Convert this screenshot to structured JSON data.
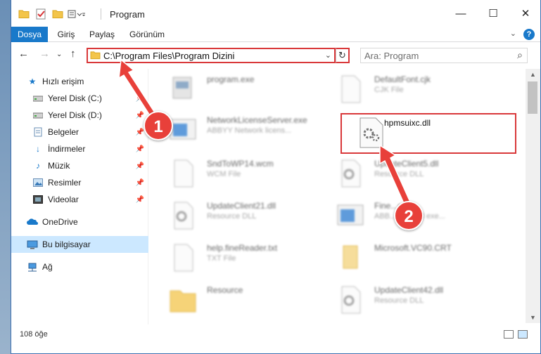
{
  "window": {
    "title": "Program",
    "controls": {
      "minimize": "—",
      "maximize": "☐",
      "close": "✕"
    }
  },
  "ribbon": {
    "tabs": [
      {
        "label": "Dosya",
        "active": true
      },
      {
        "label": "Giriş",
        "active": false
      },
      {
        "label": "Paylaş",
        "active": false
      },
      {
        "label": "Görünüm",
        "active": false
      }
    ],
    "help": "?"
  },
  "address": {
    "path": "C:\\Program Files\\Program Dizini"
  },
  "search": {
    "placeholder": "Ara: Program"
  },
  "sidebar": {
    "items": [
      {
        "label": "Hızlı erişim",
        "icon": "star-icon",
        "pinned": false
      },
      {
        "label": "Yerel Disk (C:)",
        "icon": "drive-icon",
        "pinned": true
      },
      {
        "label": "Yerel Disk (D:)",
        "icon": "drive-icon",
        "pinned": true
      },
      {
        "label": "Belgeler",
        "icon": "documents-icon",
        "pinned": true
      },
      {
        "label": "İndirmeler",
        "icon": "download-icon",
        "pinned": true
      },
      {
        "label": "Müzik",
        "icon": "music-icon",
        "pinned": true
      },
      {
        "label": "Resimler",
        "icon": "pictures-icon",
        "pinned": true
      },
      {
        "label": "Videolar",
        "icon": "videos-icon",
        "pinned": true
      },
      {
        "label": "OneDrive",
        "icon": "cloud-icon",
        "pinned": false
      },
      {
        "label": "Bu bilgisayar",
        "icon": "computer-icon",
        "pinned": false,
        "selected": true
      },
      {
        "label": "Ağ",
        "icon": "network-icon",
        "pinned": false
      }
    ]
  },
  "files": [
    {
      "name": "program.exe",
      "sub": "",
      "icon": "exe-icon"
    },
    {
      "name": "DefaultFont.cjk",
      "sub": "CJK File",
      "icon": "file-icon"
    },
    {
      "name": "NetworkLicenseServer.exe",
      "sub": "ABBYY Network licens...",
      "icon": "app-icon"
    },
    {
      "name": "hpmsuixc.dll",
      "sub": "",
      "icon": "dll-icon"
    },
    {
      "name": "SndToWP14.wcm",
      "sub": "WCM File",
      "icon": "file-icon"
    },
    {
      "name": "UpdateClient5.dll",
      "sub": "Resource DLL",
      "icon": "dll-icon"
    },
    {
      "name": "UpdateClient21.dll",
      "sub": "Resource DLL",
      "icon": "dll-icon"
    },
    {
      "name": "Fine...exe",
      "sub": "ABB...kground exe...",
      "icon": "app-icon"
    },
    {
      "name": "help.fineReader.txt",
      "sub": "TXT File",
      "icon": "file-icon"
    },
    {
      "name": "Microsoft.VC90.CRT",
      "sub": "",
      "icon": "folder-icon"
    },
    {
      "name": "Resource",
      "sub": "",
      "icon": "folder-icon"
    },
    {
      "name": "UpdateClient42.dll",
      "sub": "Resource DLL",
      "icon": "dll-icon"
    }
  ],
  "callouts": [
    "1",
    "2"
  ],
  "status": {
    "count": "108 öğe"
  },
  "colors": {
    "accent": "#1979ca",
    "highlight": "#d9383a",
    "callout": "#e8403a",
    "selection": "#cce8ff"
  }
}
